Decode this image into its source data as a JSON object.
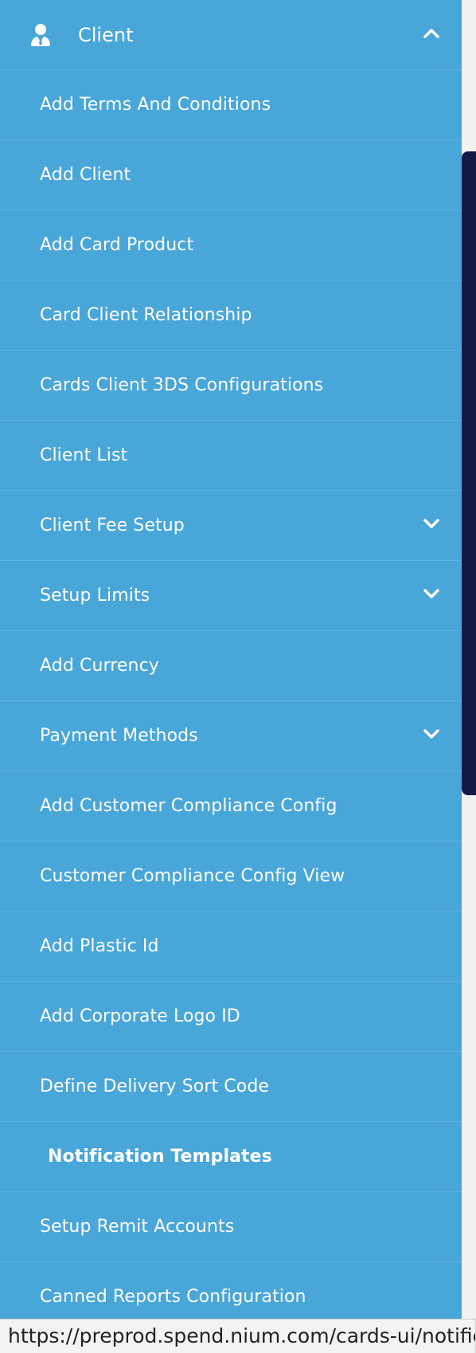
{
  "sidebar": {
    "header": {
      "label": "Client",
      "icon": "user-tie-icon",
      "expanded_icon": "chevron-up-icon"
    },
    "items": [
      {
        "label": "Add Terms And Conditions",
        "submenu": false,
        "active": false
      },
      {
        "label": "Add Client",
        "submenu": false,
        "active": false
      },
      {
        "label": "Add Card Product",
        "submenu": false,
        "active": false
      },
      {
        "label": "Card Client Relationship",
        "submenu": false,
        "active": false
      },
      {
        "label": "Cards Client 3DS Configurations",
        "submenu": false,
        "active": false
      },
      {
        "label": "Client List",
        "submenu": false,
        "active": false
      },
      {
        "label": "Client Fee Setup",
        "submenu": true,
        "active": false
      },
      {
        "label": "Setup Limits",
        "submenu": true,
        "active": false
      },
      {
        "label": "Add Currency",
        "submenu": false,
        "active": false
      },
      {
        "label": "Payment Methods",
        "submenu": true,
        "active": false
      },
      {
        "label": "Add Customer Compliance Config",
        "submenu": false,
        "active": false
      },
      {
        "label": "Customer Compliance Config View",
        "submenu": false,
        "active": false
      },
      {
        "label": "Add Plastic Id",
        "submenu": false,
        "active": false
      },
      {
        "label": "Add Corporate Logo ID",
        "submenu": false,
        "active": false
      },
      {
        "label": "Define Delivery Sort Code",
        "submenu": false,
        "active": false
      },
      {
        "label": "Notification Templates",
        "submenu": false,
        "active": true
      },
      {
        "label": "Setup Remit Accounts",
        "submenu": false,
        "active": false
      },
      {
        "label": "Canned Reports Configuration",
        "submenu": false,
        "active": false
      }
    ]
  },
  "status_bar": {
    "url": "https://preprod.spend.nium.com/cards-ui/notification"
  },
  "colors": {
    "sidebar_bg": "#49a6d8",
    "divider": "#5eb3df",
    "scroll_thumb": "#131a45",
    "text": "#ffffff"
  }
}
